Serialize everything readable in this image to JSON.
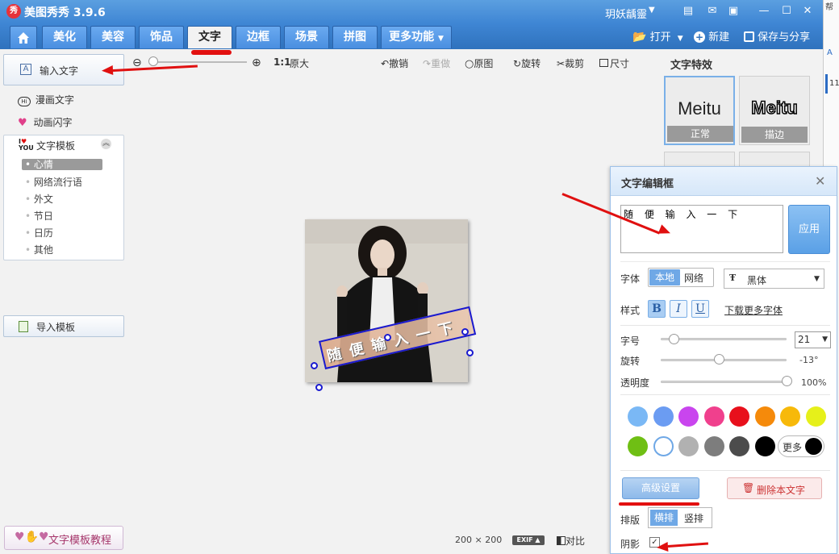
{
  "app": {
    "title": "美图秀秀 3.9.6",
    "logo_text": "秀",
    "user_name": "玥妖龋靈",
    "colors": {
      "titlebar": "#3f86d4",
      "accent": "#5aa0e6",
      "annotation": "#e01010"
    }
  },
  "window_controls": [
    "skin-icon",
    "feedback-icon",
    "menu-icon",
    "minimize-icon",
    "maximize-icon",
    "close-icon"
  ],
  "tabs": [
    {
      "label": "",
      "icon": "home-icon"
    },
    {
      "label": "美化"
    },
    {
      "label": "美容"
    },
    {
      "label": "饰品"
    },
    {
      "label": "文字",
      "active": true
    },
    {
      "label": "边框"
    },
    {
      "label": "场景"
    },
    {
      "label": "拼图"
    },
    {
      "label": "更多功能"
    }
  ],
  "top_actions": {
    "open": "打开",
    "new": "新建",
    "save_share": "保存与分享"
  },
  "left_panel": {
    "input_text": "输入文字",
    "comic_text": "漫画文字",
    "animated_text": "动画闪字",
    "templates_header": "文字模板",
    "template_categories": [
      "心情",
      "网络流行语",
      "外文",
      "节日",
      "日历",
      "其他"
    ],
    "import_template": "导入模板",
    "tutorial": "文字模板教程"
  },
  "toolbar": {
    "zoom_ratio": "1:1",
    "original_size": "原大",
    "undo": "撤销",
    "redo": "重做",
    "original": "原图",
    "rotate": "旋转",
    "crop": "裁剪",
    "resize": "尺寸"
  },
  "canvas": {
    "overlay_text": "随 便 输 入 一 下",
    "image_width": "200",
    "image_height": "200",
    "times": "×",
    "exif": "EXIF",
    "compare": "对比"
  },
  "text_effects": {
    "title": "文字特效",
    "items": [
      {
        "sample": "Meitu",
        "label": "正常"
      },
      {
        "sample": "Meitu",
        "label": "描边"
      }
    ]
  },
  "text_dialog": {
    "title": "文字编辑框",
    "text_value": "随 便 输 入 一 下",
    "apply": "应用",
    "font_label": "字体",
    "font_source_local": "本地",
    "font_source_web": "网络",
    "font_name": "黑体",
    "style_label": "样式",
    "bold": "B",
    "italic": "I",
    "underline": "U",
    "download_fonts": "下载更多字体",
    "size_label": "字号",
    "size_value": "21",
    "size_fraction": 0.1,
    "rotate_label": "旋转",
    "rotate_value": "-13°",
    "rotate_fraction": 0.46,
    "opacity_label": "透明度",
    "opacity_value": "100%",
    "opacity_fraction": 1.0,
    "colors_row1": [
      "#7ab8f5",
      "#6b9cf2",
      "#c945ee",
      "#f0408d",
      "#e8101c",
      "#f58a0b",
      "#f7b90a",
      "#e6f01a"
    ],
    "colors_row2": [
      "#6fbf14",
      "#ffffff",
      "#b1b1b1",
      "#7d7d7d",
      "#4c4c4c",
      "#000000"
    ],
    "more_colors": "更多",
    "advanced": "高级设置",
    "delete_text": "删除本文字",
    "layout_label": "排版",
    "layout_horizontal": "横排",
    "layout_vertical": "竖排",
    "shadow_label": "阴影",
    "shadow_checked": "✓"
  },
  "right_strip": {
    "top_text": "帮",
    "item_text": "11"
  }
}
